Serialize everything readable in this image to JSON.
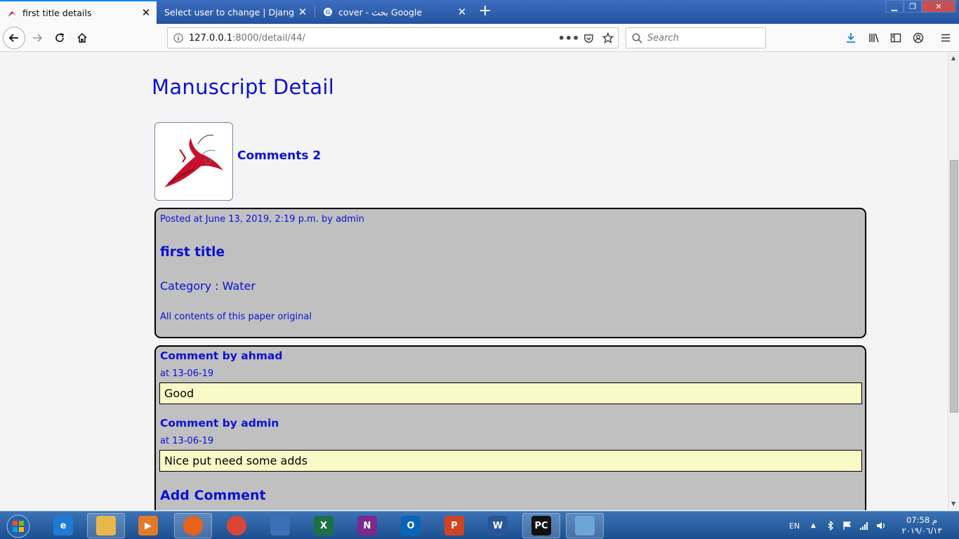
{
  "browser": {
    "tabs": [
      {
        "title": "first title details",
        "active": true
      },
      {
        "title": "Select user to change | Django site a",
        "active": false
      },
      {
        "title": "cover - بحث Google",
        "active": false
      }
    ],
    "url_host": "127.0.0.1",
    "url_rest": ":8000/detail/44/",
    "search_placeholder": "Search"
  },
  "page": {
    "heading": "Manuscript Detail",
    "comments_link": "Comments 2",
    "post": {
      "posted": "Posted at June 13, 2019, 2:19 p.m. by admin",
      "title": "first title",
      "category": "Category : Water",
      "description": "All contents of this paper original"
    },
    "comments": [
      {
        "by": "Comment by ahmad",
        "date": "at 13-06-19",
        "body": "Good"
      },
      {
        "by": "Comment by admin",
        "date": "at 13-06-19",
        "body": "Nice put need some adds"
      }
    ],
    "add_comment": "Add Comment"
  },
  "taskbar": {
    "apps": [
      {
        "name": "ie",
        "letter": "e",
        "color": "#1f7ad8"
      },
      {
        "name": "explorer",
        "letter": "",
        "color": "#e6b74c"
      },
      {
        "name": "media",
        "letter": "▶",
        "color": "#e27a2a"
      },
      {
        "name": "firefox",
        "letter": "",
        "color": "#e8631a"
      },
      {
        "name": "chrome",
        "letter": "",
        "color": "#db4437"
      },
      {
        "name": "network",
        "letter": "",
        "color": "#3b6fb8"
      },
      {
        "name": "excel",
        "letter": "X",
        "color": "#1d7044"
      },
      {
        "name": "onenote",
        "letter": "N",
        "color": "#7b2b8e"
      },
      {
        "name": "outlook",
        "letter": "O",
        "color": "#0a64b8"
      },
      {
        "name": "powerpoint",
        "letter": "P",
        "color": "#d04423"
      },
      {
        "name": "word",
        "letter": "W",
        "color": "#2a5699"
      },
      {
        "name": "pycharm",
        "letter": "PC",
        "color": "#111111"
      },
      {
        "name": "paint",
        "letter": "",
        "color": "#6ea5d8"
      }
    ],
    "lang": "EN",
    "time": "07:58 م",
    "date": "٢٠١٩/٠٦/١٣"
  }
}
